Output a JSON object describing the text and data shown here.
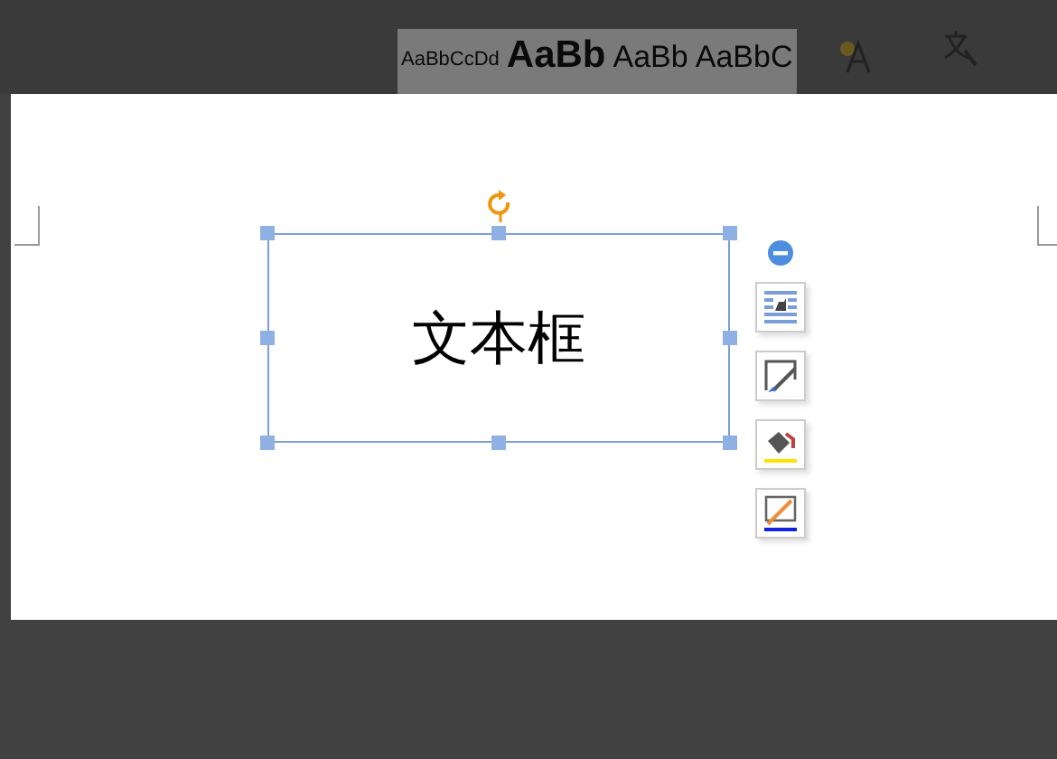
{
  "ribbon": {
    "styles": [
      {
        "preview": "AaBbCcDd",
        "kind": "normal"
      },
      {
        "preview": "AaBb",
        "kind": "h1"
      },
      {
        "preview": "AaBb",
        "kind": "h2"
      },
      {
        "preview": "AaBbC",
        "kind": "h3"
      }
    ]
  },
  "text_box": {
    "text": "文本框",
    "selected": true
  }
}
